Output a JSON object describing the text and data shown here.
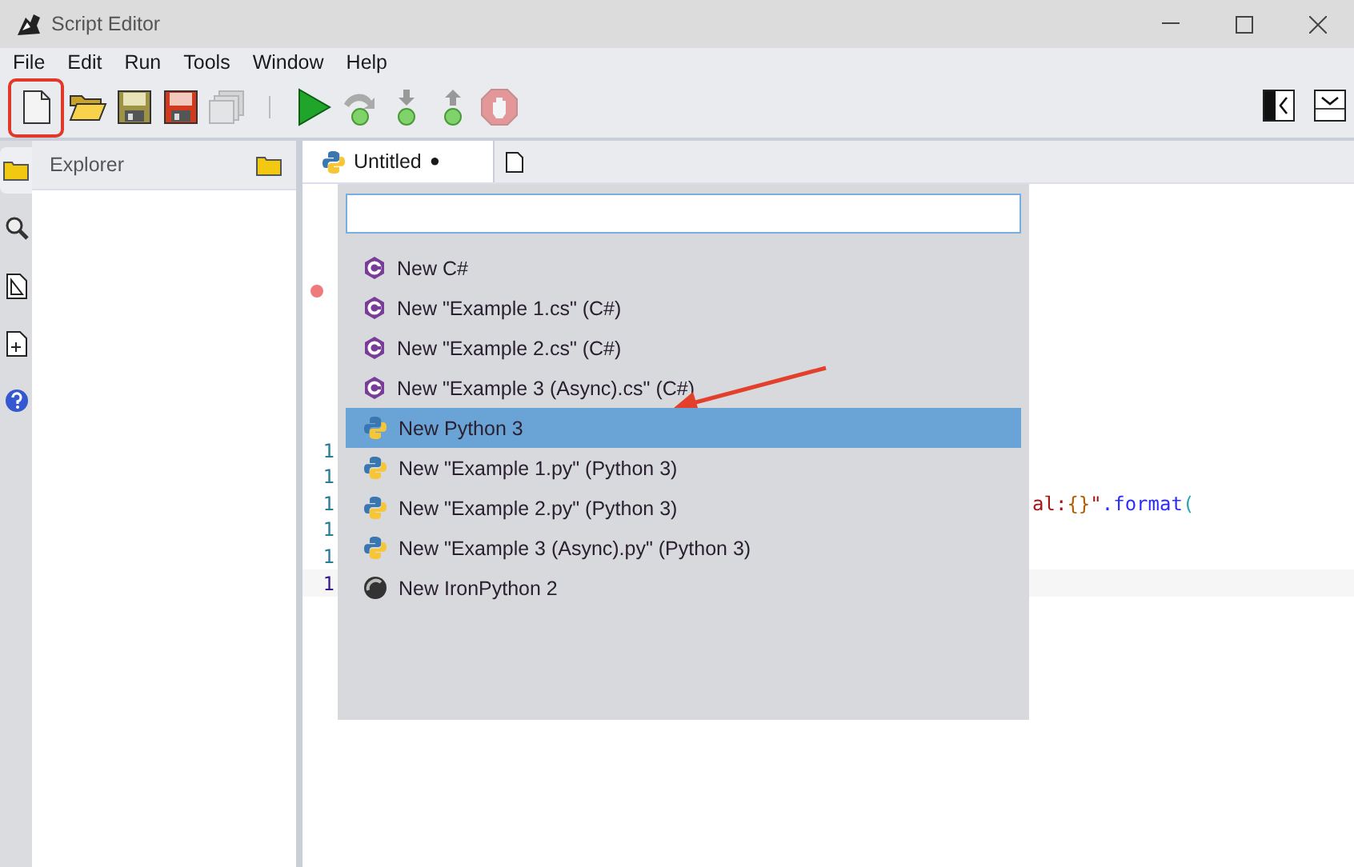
{
  "window": {
    "title": "Script Editor"
  },
  "menu": [
    "File",
    "Edit",
    "Run",
    "Tools",
    "Window",
    "Help"
  ],
  "toolbar": [
    {
      "kind": "new",
      "disabled": false,
      "highlighted": true
    },
    {
      "kind": "open",
      "disabled": false,
      "highlighted": false
    },
    {
      "kind": "save",
      "disabled": false,
      "highlighted": false
    },
    {
      "kind": "save-as",
      "disabled": false,
      "highlighted": false
    },
    {
      "kind": "save-all",
      "disabled": true,
      "highlighted": false
    },
    {
      "kind": "separator"
    },
    {
      "kind": "run",
      "disabled": false,
      "highlighted": false
    },
    {
      "kind": "step-over",
      "disabled": false,
      "highlighted": false
    },
    {
      "kind": "step-into",
      "disabled": false,
      "highlighted": false
    },
    {
      "kind": "step-out",
      "disabled": false,
      "highlighted": false
    },
    {
      "kind": "stop",
      "disabled": true,
      "highlighted": false
    }
  ],
  "sidebar": [
    {
      "kind": "folder",
      "selected": true
    },
    {
      "kind": "search",
      "selected": false
    },
    {
      "kind": "chart-doc",
      "selected": false
    },
    {
      "kind": "plus-doc",
      "selected": false
    },
    {
      "kind": "help",
      "selected": false
    }
  ],
  "explorer": {
    "title": "Explorer"
  },
  "editor": {
    "tab": {
      "label": "Untitled",
      "modified_indicator": "●",
      "selected": true
    },
    "breakpoint": true,
    "line_numbers": [
      {
        "text": "1",
        "current": false
      },
      {
        "text": "1",
        "current": false
      },
      {
        "text": "1",
        "current": false
      },
      {
        "text": "1",
        "current": false
      },
      {
        "text": "1",
        "current": false
      },
      {
        "text": "1",
        "current": true
      }
    ],
    "code": [
      {
        "text": "al:",
        "kind": "string"
      },
      {
        "text": "{}",
        "kind": "brace"
      },
      {
        "text": "\"",
        "kind": "string"
      },
      {
        "text": ".format",
        "kind": "method"
      },
      {
        "text": "(",
        "kind": "paren"
      }
    ]
  },
  "new_script_menu": {
    "items": [
      {
        "label": "New C#",
        "kind": "csharp",
        "selected": false
      },
      {
        "label": "New \"Example 1.cs\" (C#)",
        "kind": "csharp",
        "selected": false
      },
      {
        "label": "New \"Example 2.cs\" (C#)",
        "kind": "csharp",
        "selected": false
      },
      {
        "label": "New \"Example 3 (Async).cs\" (C#)",
        "kind": "csharp",
        "selected": false
      },
      {
        "label": "New Python 3",
        "kind": "python",
        "selected": true
      },
      {
        "label": "New \"Example 1.py\" (Python 3)",
        "kind": "python",
        "selected": false
      },
      {
        "label": "New \"Example 2.py\" (Python 3)",
        "kind": "python",
        "selected": false
      },
      {
        "label": "New \"Example 3 (Async).py\" (Python 3)",
        "kind": "python",
        "selected": false
      },
      {
        "label": "New IronPython 2",
        "kind": "ironpython",
        "selected": false
      }
    ]
  }
}
